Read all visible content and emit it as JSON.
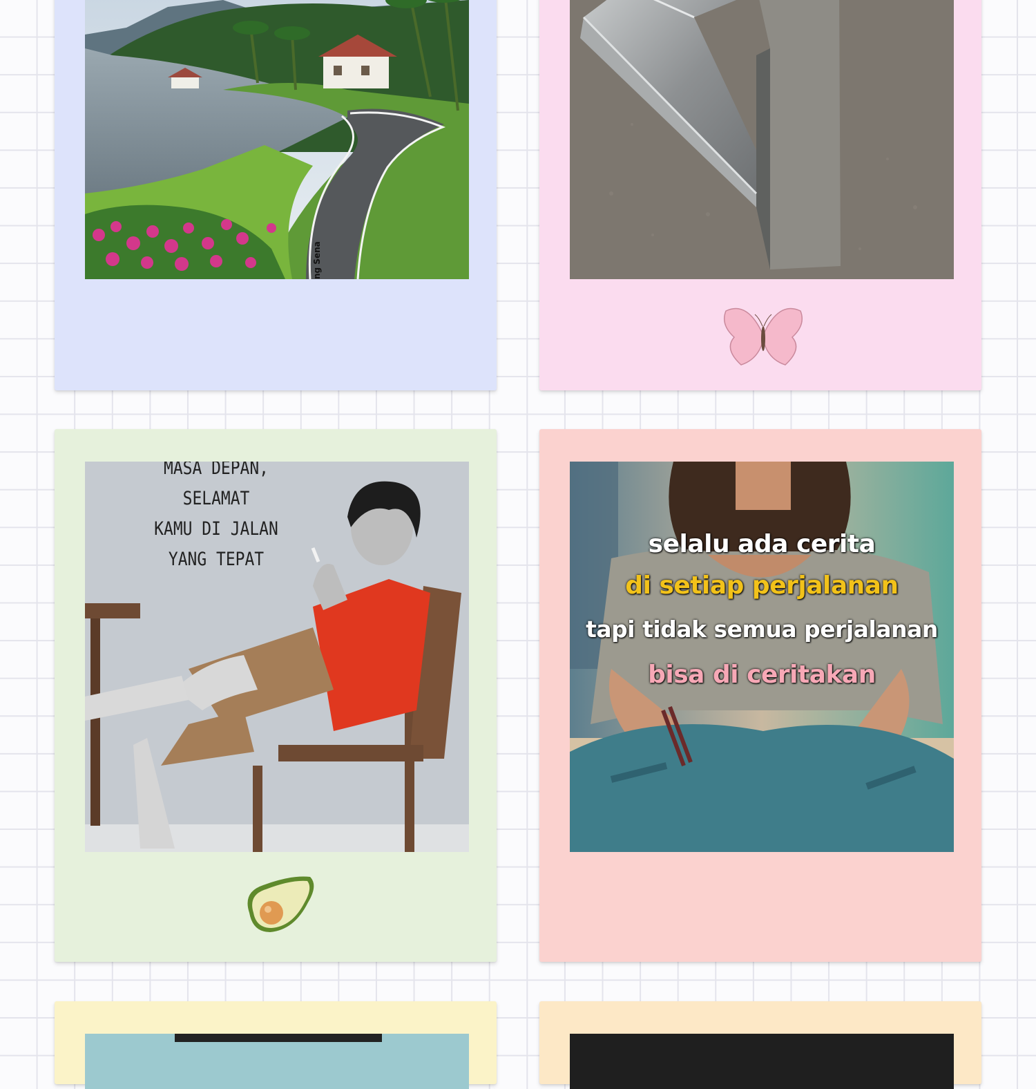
{
  "cards": [
    {
      "color": "#dde3fb",
      "photo": "lake-road-photo",
      "watermark": "ng Sena"
    },
    {
      "color": "#fbdcef",
      "photo": "steel-frame-photo",
      "sticker": "butterfly-sticker"
    },
    {
      "color": "#e6f1dc",
      "photo": "man-in-chair-illustration",
      "sticker": "avocado-sticker",
      "text_lines": [
        "MASA DEPAN,",
        "SELAMAT",
        "KAMU DI JALAN",
        "YANG TEPAT"
      ]
    },
    {
      "color": "#fbd2cf",
      "photo": "sitting-man-photo",
      "caption_lines": [
        "selalu ada cerita",
        "di setiap perjalanan",
        "tapi tidak semua perjalanan",
        "bisa di ceritakan"
      ],
      "caption_colors": [
        "#ffffff",
        "#f2c21a",
        "#ffffff",
        "#f7a8b6"
      ]
    },
    {
      "color": "#fbf3c8"
    },
    {
      "color": "#fde8c6"
    }
  ]
}
